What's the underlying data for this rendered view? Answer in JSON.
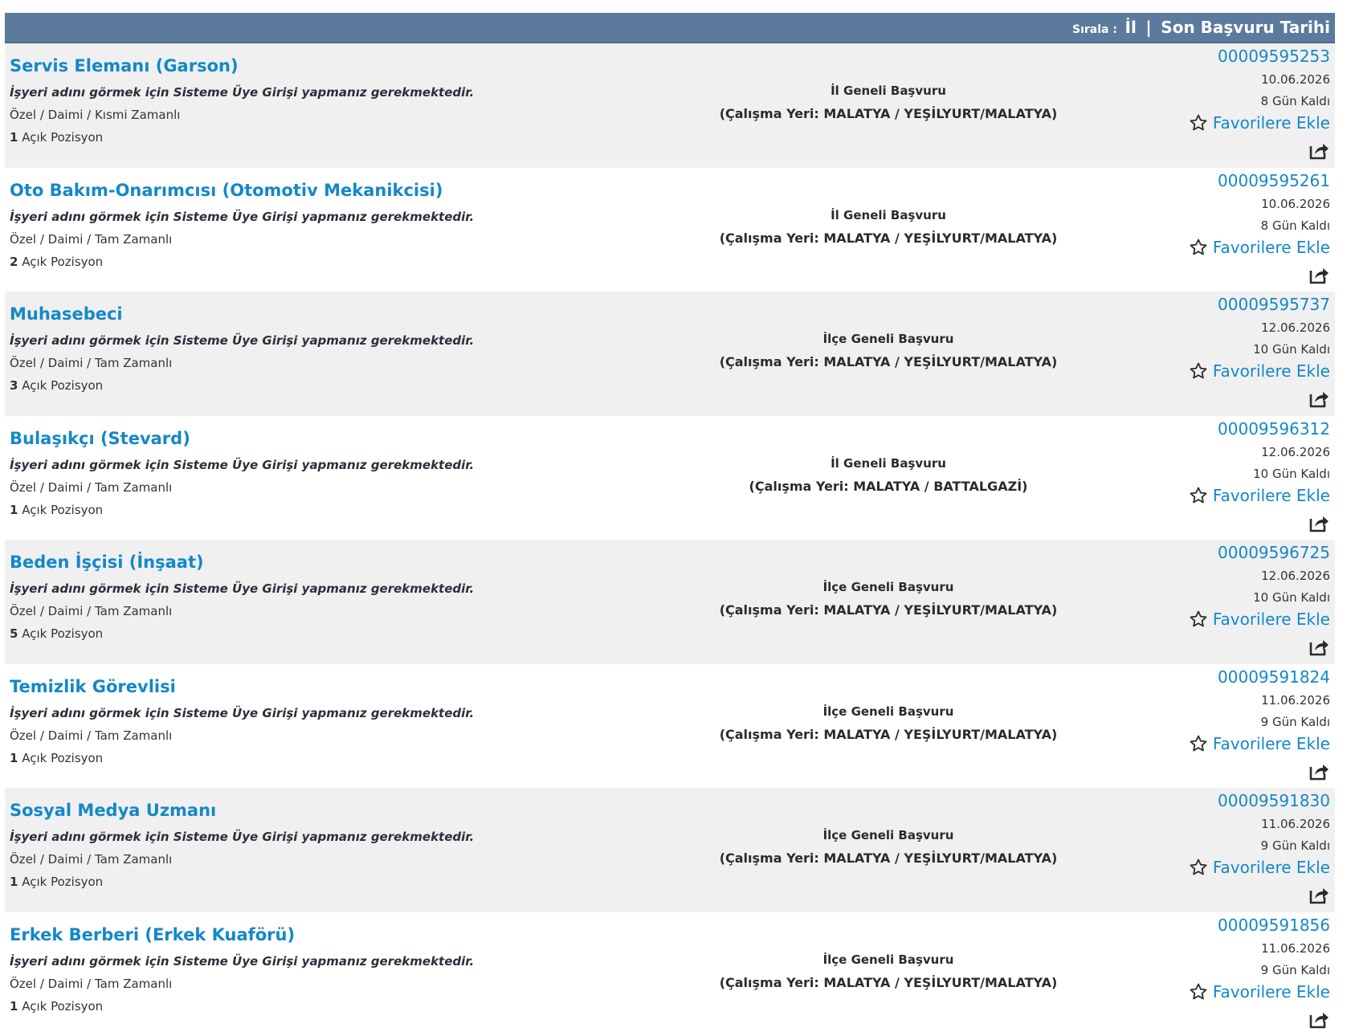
{
  "sortbar": {
    "label": "Sırala :",
    "options": [
      "İl",
      "Son Başvuru Tarihi"
    ],
    "separator": "|"
  },
  "favorite_label": "Favorilere Ekle",
  "employer_note": "İşyeri adını görmek için Sisteme Üye Girişi yapmanız gerekmektedir.",
  "positions_suffix": "Açık Pozisyon",
  "colors": {
    "link": "#1488c8",
    "header_bar": "#5c7a9d",
    "row_alt": "#f0f0f0"
  },
  "listings": [
    {
      "title": "Servis Elemanı (Garson)",
      "employment": "Özel / Daimi / Kısmi Zamanlı",
      "positions": "1",
      "scope": "İl Geneli Başvuru",
      "place": "(Çalışma Yeri: MALATYA / YEŞİLYURT/MALATYA)",
      "ilan_no": "00009595253",
      "deadline": "10.06.2026",
      "remaining": "8 Gün Kaldı"
    },
    {
      "title": "Oto Bakım-Onarımcısı (Otomotiv Mekanikcisi)",
      "employment": "Özel / Daimi / Tam Zamanlı",
      "positions": "2",
      "scope": "İl Geneli Başvuru",
      "place": "(Çalışma Yeri: MALATYA / YEŞİLYURT/MALATYA)",
      "ilan_no": "00009595261",
      "deadline": "10.06.2026",
      "remaining": "8 Gün Kaldı"
    },
    {
      "title": "Muhasebeci",
      "employment": "Özel / Daimi / Tam Zamanlı",
      "positions": "3",
      "scope": "İlçe Geneli Başvuru",
      "place": "(Çalışma Yeri: MALATYA / YEŞİLYURT/MALATYA)",
      "ilan_no": "00009595737",
      "deadline": "12.06.2026",
      "remaining": "10 Gün Kaldı"
    },
    {
      "title": "Bulaşıkçı (Stevard)",
      "employment": "Özel / Daimi / Tam Zamanlı",
      "positions": "1",
      "scope": "İl Geneli Başvuru",
      "place": "(Çalışma Yeri: MALATYA / BATTALGAZİ)",
      "ilan_no": "00009596312",
      "deadline": "12.06.2026",
      "remaining": "10 Gün Kaldı"
    },
    {
      "title": "Beden İşçisi (İnşaat)",
      "employment": "Özel / Daimi / Tam Zamanlı",
      "positions": "5",
      "scope": "İlçe Geneli Başvuru",
      "place": "(Çalışma Yeri: MALATYA / YEŞİLYURT/MALATYA)",
      "ilan_no": "00009596725",
      "deadline": "12.06.2026",
      "remaining": "10 Gün Kaldı"
    },
    {
      "title": "Temizlik Görevlisi",
      "employment": "Özel / Daimi / Tam Zamanlı",
      "positions": "1",
      "scope": "İlçe Geneli Başvuru",
      "place": "(Çalışma Yeri: MALATYA / YEŞİLYURT/MALATYA)",
      "ilan_no": "00009591824",
      "deadline": "11.06.2026",
      "remaining": "9 Gün Kaldı"
    },
    {
      "title": "Sosyal Medya Uzmanı",
      "employment": "Özel / Daimi / Tam Zamanlı",
      "positions": "1",
      "scope": "İlçe Geneli Başvuru",
      "place": "(Çalışma Yeri: MALATYA / YEŞİLYURT/MALATYA)",
      "ilan_no": "00009591830",
      "deadline": "11.06.2026",
      "remaining": "9 Gün Kaldı"
    },
    {
      "title": "Erkek Berberi (Erkek Kuaförü)",
      "employment": "Özel / Daimi / Tam Zamanlı",
      "positions": "1",
      "scope": "İlçe Geneli Başvuru",
      "place": "(Çalışma Yeri: MALATYA / YEŞİLYURT/MALATYA)",
      "ilan_no": "00009591856",
      "deadline": "11.06.2026",
      "remaining": "9 Gün Kaldı"
    }
  ]
}
